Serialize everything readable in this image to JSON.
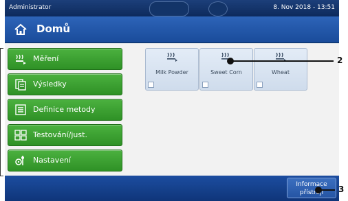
{
  "status": {
    "user": "Administrator",
    "datetime": "8. Nov 2018 - 13:51"
  },
  "title": {
    "text": "Domů"
  },
  "menu": {
    "items": [
      {
        "label": "Měření",
        "icon": "measure-icon"
      },
      {
        "label": "Výsledky",
        "icon": "results-icon"
      },
      {
        "label": "Definice metody",
        "icon": "method-definition-icon"
      },
      {
        "label": "Testování/just.",
        "icon": "test-adjust-icon"
      },
      {
        "label": "Nastavení",
        "icon": "settings-icon"
      }
    ]
  },
  "shortcuts": [
    {
      "label": "Milk Powder",
      "icon": "heating-icon"
    },
    {
      "label": "Sweet Corn",
      "icon": "heating-icon"
    },
    {
      "label": "Wheat",
      "icon": "heating-icon"
    }
  ],
  "footer": {
    "info_line1": "Informace",
    "info_line2": "přístroji"
  },
  "callouts": {
    "c2": "2",
    "c3": "3"
  },
  "colors": {
    "menu_green": "#3aa02f",
    "header_blue": "#1a4c9b",
    "tile_blue": "#d9e4f1"
  }
}
